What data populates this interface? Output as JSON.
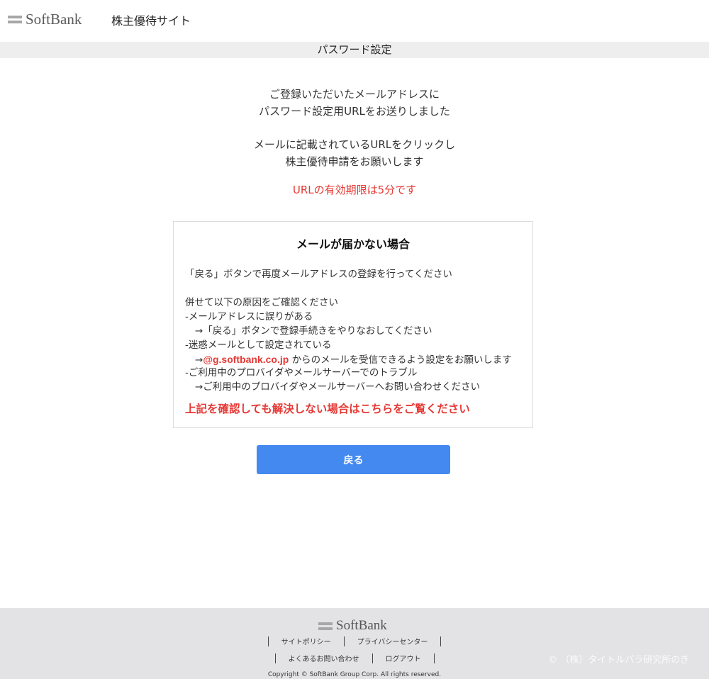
{
  "header": {
    "brand": "SoftBank",
    "site_name": "株主優待サイト"
  },
  "page_title": "パスワード設定",
  "messages": {
    "line1": "ご登録いただいたメールアドレスに",
    "line2": "パスワード設定用URLをお送りしました",
    "line3": "メールに記載されているURLをクリックし",
    "line4": "株主優待申請をお願いします",
    "expiry": "URLの有効期限は5分です"
  },
  "infobox": {
    "title": "メールが届かない場合",
    "back_instruction": "「戻る」ボタンで再度メールアドレスの登録を行ってください",
    "check_intro": "併せて以下の原因をご確認ください",
    "cause1": "-メールアドレスに誤りがある",
    "cause1_fix": "→「戻る」ボタンで登録手続きをやりなおしてください",
    "cause2": "-迷惑メールとして設定されている",
    "cause2_arrow": "→",
    "cause2_domain": "@g.softbank.co.jp",
    "cause2_fix": " からのメールを受信できるよう設定をお願いします",
    "cause3": "-ご利用中のプロバイダやメールサーバーでのトラブル",
    "cause3_fix": "→ご利用中のプロバイダやメールサーバーへお問い合わせください",
    "help_link": "上記を確認しても解決しない場合はこちらをご覧ください"
  },
  "buttons": {
    "back": "戻る"
  },
  "footer": {
    "brand": "SoftBank",
    "links_row1": [
      "サイトポリシー",
      "プライバシーセンター"
    ],
    "links_row2": [
      "よくあるお問い合わせ",
      "ログアウト"
    ],
    "copyright": "Copyright © SoftBank Group Corp. All rights reserved.",
    "watermark": "© （株）タイトルバラ研究所のき"
  },
  "colors": {
    "accent_red": "#e53935",
    "button_blue": "#4489f0",
    "titlebar_bg": "#eeeeee",
    "footer_bg": "#e3e3e6"
  }
}
